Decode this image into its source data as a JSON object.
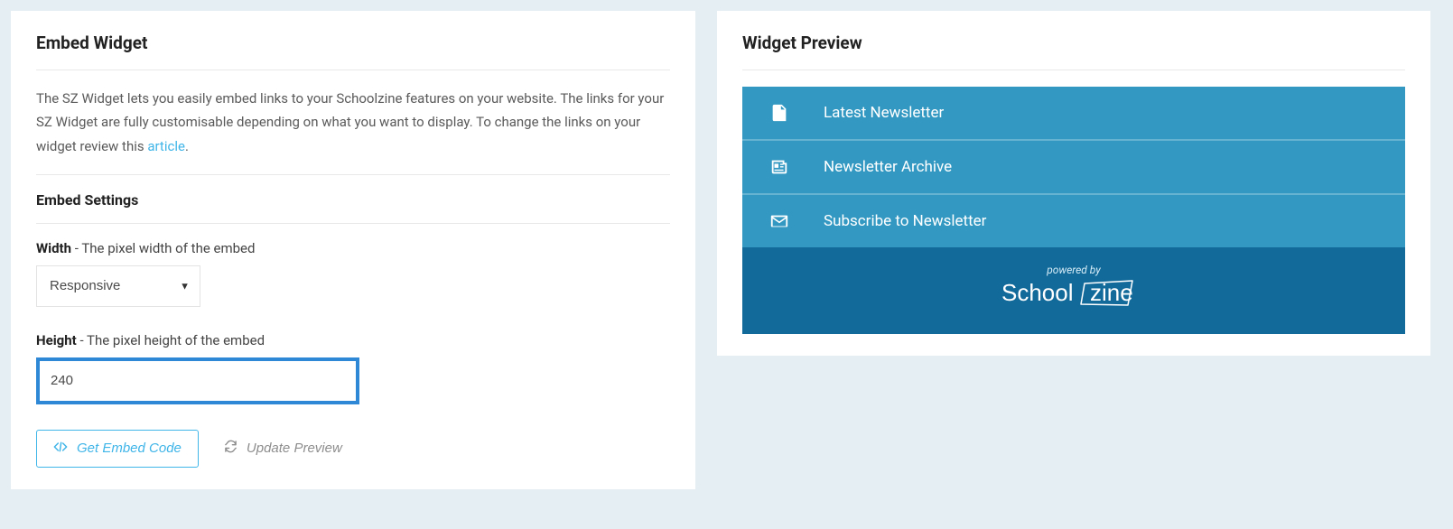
{
  "embed": {
    "title": "Embed Widget",
    "description": "The SZ Widget lets you easily embed links to your Schoolzine features on your website. The links for your SZ Widget are fully customisable depending on what you want to display. To change the links on your widget review this ",
    "link_text": "article",
    "link_suffix": ".",
    "settings_heading": "Embed Settings",
    "width_label": "Width",
    "width_hint": " - The pixel width of the embed",
    "width_value": "Responsive",
    "height_label": "Height",
    "height_hint": " - The pixel height of the embed",
    "height_value": "240",
    "get_code_label": "Get Embed Code",
    "update_label": "Update Preview"
  },
  "preview": {
    "title": "Widget Preview",
    "items": [
      {
        "label": "Latest Newsletter"
      },
      {
        "label": "Newsletter Archive"
      },
      {
        "label": "Subscribe to Newsletter"
      }
    ],
    "powered": "powered by",
    "brand_a": "School",
    "brand_b": "zine"
  }
}
